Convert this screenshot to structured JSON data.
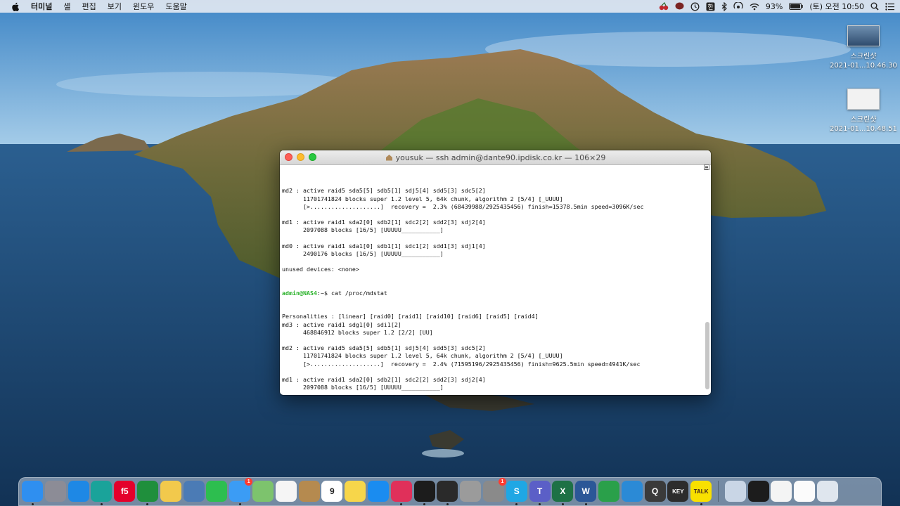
{
  "menubar": {
    "app_name": "터미널",
    "menus": [
      "셸",
      "편집",
      "보기",
      "윈도우",
      "도움말"
    ],
    "battery": "93%",
    "datetime": "(토) 오전 10:50"
  },
  "desktop_icons": [
    {
      "name": "스크린샷",
      "caption": "2021-01...10.46.30"
    },
    {
      "name": "스크린샷",
      "caption": "2021-01...10.48.51"
    }
  ],
  "terminal": {
    "title": "yousuk — ssh admin@dante90.ipdisk.co.kr — 106×29",
    "prompt": "admin@NAS4",
    "prompt_suffix": ":~$",
    "command": " cat /proc/mdstat",
    "lines": [
      "md2 : active raid5 sda5[5] sdb5[1] sdj5[4] sdd5[3] sdc5[2]",
      "      11701741824 blocks super 1.2 level 5, 64k chunk, algorithm 2 [5/4] [_UUUU]",
      "      [>....................]  recovery =  2.3% (68439988/2925435456) finish=15378.5min speed=3096K/sec",
      "",
      "md1 : active raid1 sda2[0] sdb2[1] sdc2[2] sdd2[3] sdj2[4]",
      "      2097088 blocks [16/5] [UUUUU___________]",
      "",
      "md0 : active raid1 sda1[0] sdb1[1] sdc1[2] sdd1[3] sdj1[4]",
      "      2490176 blocks [16/5] [UUUUU___________]",
      "",
      "unused devices: <none>"
    ],
    "lines_after": [
      "Personalities : [linear] [raid0] [raid1] [raid10] [raid6] [raid5] [raid4]",
      "md3 : active raid1 sdg1[0] sdi1[2]",
      "      468846912 blocks super 1.2 [2/2] [UU]",
      "",
      "md2 : active raid5 sda5[5] sdb5[1] sdj5[4] sdd5[3] sdc5[2]",
      "      11701741824 blocks super 1.2 level 5, 64k chunk, algorithm 2 [5/4] [_UUUU]",
      "      [>....................]  recovery =  2.4% (71595196/2925435456) finish=9625.5min speed=4941K/sec",
      "",
      "md1 : active raid1 sda2[0] sdb2[1] sdc2[2] sdd2[3] sdj2[4]",
      "      2097088 blocks [16/5] [UUUUU___________]",
      "",
      "md0 : active raid1 sda1[0] sdb1[1] sdc1[2] sdd1[3] sdj1[4]",
      "      2490176 blocks [16/5] [UUUUU___________]",
      "",
      "unused devices: <none>"
    ]
  },
  "dock": {
    "apps": [
      {
        "name": "finder-icon",
        "label": "",
        "bg": "#2f8ff0",
        "running": true
      },
      {
        "name": "launchpad-icon",
        "label": "",
        "bg": "#8c8c96",
        "running": false
      },
      {
        "name": "safari-icon",
        "label": "",
        "bg": "#1e88e5",
        "running": false
      },
      {
        "name": "edge-icon",
        "label": "",
        "bg": "#1aa39a",
        "running": true
      },
      {
        "name": "f5-icon",
        "label": "f5",
        "bg": "#e4002b",
        "running": false
      },
      {
        "name": "network-icon",
        "label": "",
        "bg": "#1f8f3c",
        "running": true
      },
      {
        "name": "messenger-icon",
        "label": "",
        "bg": "#f2c94c",
        "running": false
      },
      {
        "name": "preview-icon",
        "label": "",
        "bg": "#4b7bb5",
        "running": false
      },
      {
        "name": "facetime-icon",
        "label": "",
        "bg": "#2dbe4f",
        "running": false
      },
      {
        "name": "messages-icon",
        "label": "",
        "bg": "#3b9cf5",
        "badge": "1",
        "running": true
      },
      {
        "name": "maps-icon",
        "label": "",
        "bg": "#7dc36d",
        "running": false
      },
      {
        "name": "photos-icon",
        "label": "",
        "bg": "#f5f5f5",
        "running": false
      },
      {
        "name": "contacts-icon",
        "label": "",
        "bg": "#b58a4f",
        "running": false
      },
      {
        "name": "calendar-icon",
        "label": "9",
        "bg": "#ffffff",
        "running": false
      },
      {
        "name": "notes-icon",
        "label": "",
        "bg": "#f7d64a",
        "running": false
      },
      {
        "name": "app-store-icon",
        "label": "",
        "bg": "#1a8cf0",
        "running": false
      },
      {
        "name": "bear-icon",
        "label": "",
        "bg": "#e0305a",
        "running": true
      },
      {
        "name": "terminal-dock-icon",
        "label": "",
        "bg": "#1c1c1c",
        "running": true
      },
      {
        "name": "terminal-alt-icon",
        "label": "",
        "bg": "#2a2a2a",
        "running": true
      },
      {
        "name": "utility-icon",
        "label": "",
        "bg": "#9b9b9b",
        "running": false
      },
      {
        "name": "system-preferences-icon",
        "label": "",
        "bg": "#8a8a8a",
        "badge": "1",
        "running": false
      },
      {
        "name": "skype-icon",
        "label": "S",
        "bg": "#1fa7e4",
        "running": true
      },
      {
        "name": "teams-icon",
        "label": "T",
        "bg": "#5b5fc7",
        "running": true
      },
      {
        "name": "excel-icon",
        "label": "X",
        "bg": "#1e7145",
        "running": true
      },
      {
        "name": "word-icon",
        "label": "W",
        "bg": "#2b5797",
        "running": true
      },
      {
        "name": "globe-icon",
        "label": "",
        "bg": "#2aa04a",
        "running": false
      },
      {
        "name": "wifi-tool-icon",
        "label": "",
        "bg": "#2b8ad6",
        "running": false
      },
      {
        "name": "search-tool-icon",
        "label": "Q",
        "bg": "#3a3a3a",
        "running": false
      },
      {
        "name": "keychain-icon",
        "label": "KEY",
        "bg": "#2c2c2c",
        "running": false
      },
      {
        "name": "kakaotalk-icon",
        "label": "TALK",
        "bg": "#f9e000",
        "running": true
      }
    ],
    "right_items": [
      {
        "name": "image-capture-icon",
        "label": "",
        "bg": "#c9d6e6"
      },
      {
        "name": "terminal-thumb-icon",
        "label": "",
        "bg": "#1c1c1c"
      },
      {
        "name": "window-thumb-icon",
        "label": "",
        "bg": "#f4f4f4"
      },
      {
        "name": "document-icon",
        "label": "",
        "bg": "#fbfbfb"
      },
      {
        "name": "trash-icon",
        "label": "",
        "bg": "#dfe6ee"
      }
    ]
  }
}
